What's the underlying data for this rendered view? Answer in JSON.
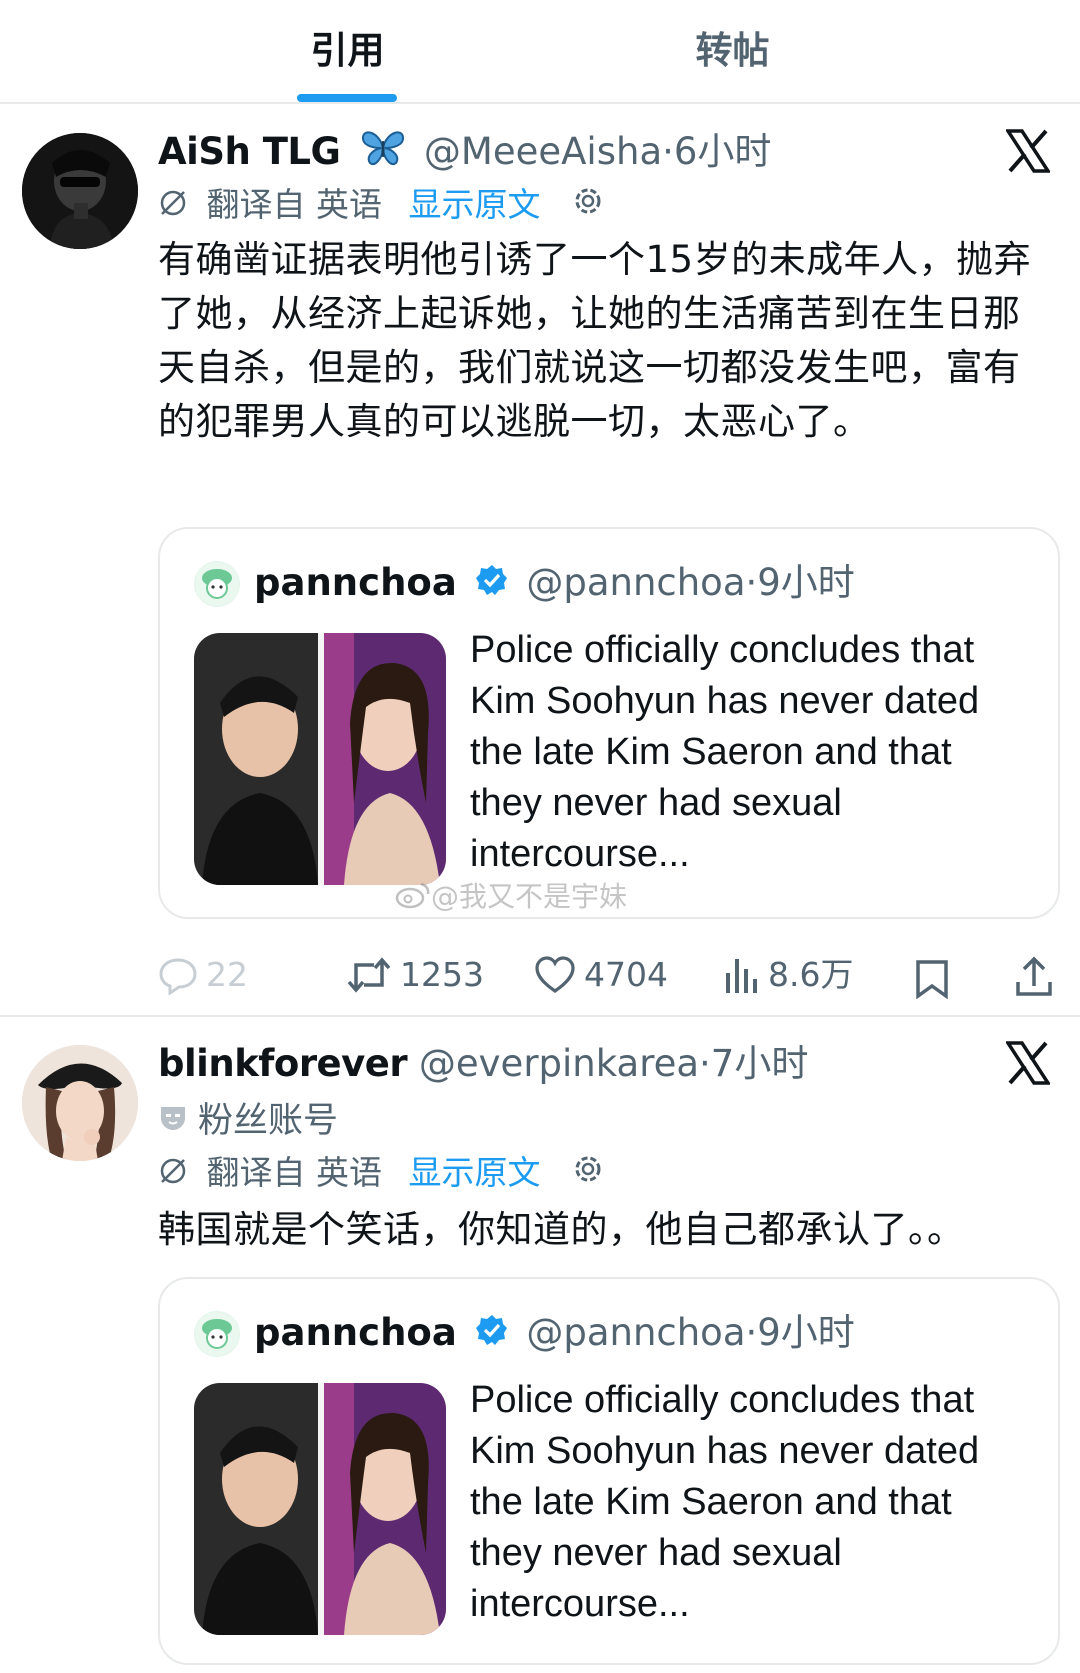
{
  "tabs": {
    "quotes": "引用",
    "reposts": "转帖"
  },
  "tweets": [
    {
      "author_name": "AiSh TLG",
      "handle": "@MeeeAisha",
      "sep": "·",
      "time": "6小时",
      "translate_label": "翻译自 英语",
      "show_original": "显示原文",
      "text": "有确凿证据表明他引诱了一个15岁的未成年人，抛弃了她，从经济上起诉她，让她的生活痛苦到在生日那天自杀，但是的，我们就说这一切都没发生吧，富有的犯罪男人真的可以逃脱一切，太恶心了。",
      "quote": {
        "name": "pannchoa",
        "handle": "@pannchoa",
        "sep": "·",
        "time": "9小时",
        "text": "Police officially concludes that Kim Soohyun has never dated the late Kim Saeron and that they never had sexual intercourse..."
      },
      "stats": {
        "replies": "22",
        "reposts": "1253",
        "likes": "4704",
        "views": "8.6万"
      }
    },
    {
      "author_name": "blinkforever",
      "handle": "@everpinkarea",
      "sep": "·",
      "time": "7小时",
      "fan_label": "粉丝账号",
      "translate_label": "翻译自 英语",
      "show_original": "显示原文",
      "text": "韩国就是个笑话，你知道的，他自己都承认了。。",
      "quote": {
        "name": "pannchoa",
        "handle": "@pannchoa",
        "sep": "·",
        "time": "9小时",
        "text": "Police officially concludes that Kim Soohyun has never dated the late Kim Saeron and that they never had sexual intercourse..."
      }
    }
  ],
  "watermark": "@我又不是宇妹",
  "colors": {
    "accent": "#1d9bf0",
    "text": "#0f1419",
    "muted": "#536471",
    "border": "#e7e9ea",
    "verified": "#1d9bf0"
  },
  "icons": [
    "x-logo-icon",
    "butterfly-emoji-icon",
    "translate-icon",
    "gear-icon",
    "verified-badge-icon",
    "reply-icon",
    "retweet-icon",
    "like-icon",
    "views-icon",
    "bookmark-icon",
    "share-icon",
    "fan-mask-icon",
    "weibo-icon"
  ]
}
